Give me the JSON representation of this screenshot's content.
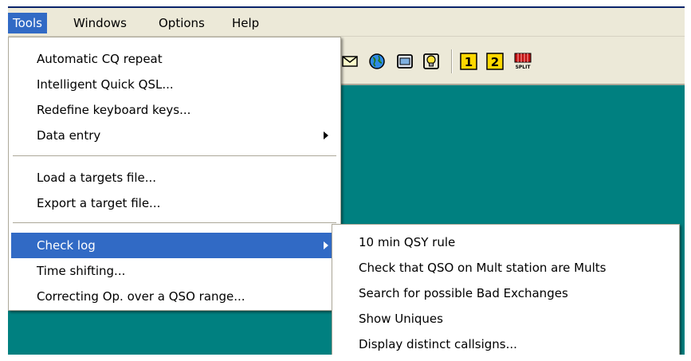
{
  "menubar": {
    "items": [
      {
        "label": "Tools"
      },
      {
        "label": "Windows"
      },
      {
        "label": "Options"
      },
      {
        "label": "Help"
      }
    ]
  },
  "tools_menu": {
    "items": [
      {
        "label": "Automatic CQ repeat"
      },
      {
        "label": "Intelligent Quick QSL..."
      },
      {
        "label": "Redefine keyboard keys..."
      },
      {
        "label": "Data entry"
      },
      {
        "label": "Load a targets file..."
      },
      {
        "label": "Export a target file..."
      },
      {
        "label": "Check log"
      },
      {
        "label": "Time shifting..."
      },
      {
        "label": "Correcting Op. over a QSO range..."
      }
    ]
  },
  "check_log_submenu": {
    "items": [
      {
        "label": "10 min QSY rule"
      },
      {
        "label": "Check that QSO on Mult station are Mults"
      },
      {
        "label": "Search for possible Bad Exchanges"
      },
      {
        "label": "Show Uniques"
      },
      {
        "label": "Display distinct callsigns..."
      }
    ]
  },
  "toolbar": {
    "icons": [
      "mail-icon",
      "globe-icon",
      "window-icon",
      "bulb-icon",
      "radio-1-icon",
      "radio-2-icon",
      "split-icon"
    ],
    "radio1_label": "1",
    "radio2_label": "2",
    "split_label": "SPLIT"
  },
  "colors": {
    "workspace": "#008080",
    "menu_highlight": "#316ac5",
    "menubar_bg": "#ece9d8"
  }
}
